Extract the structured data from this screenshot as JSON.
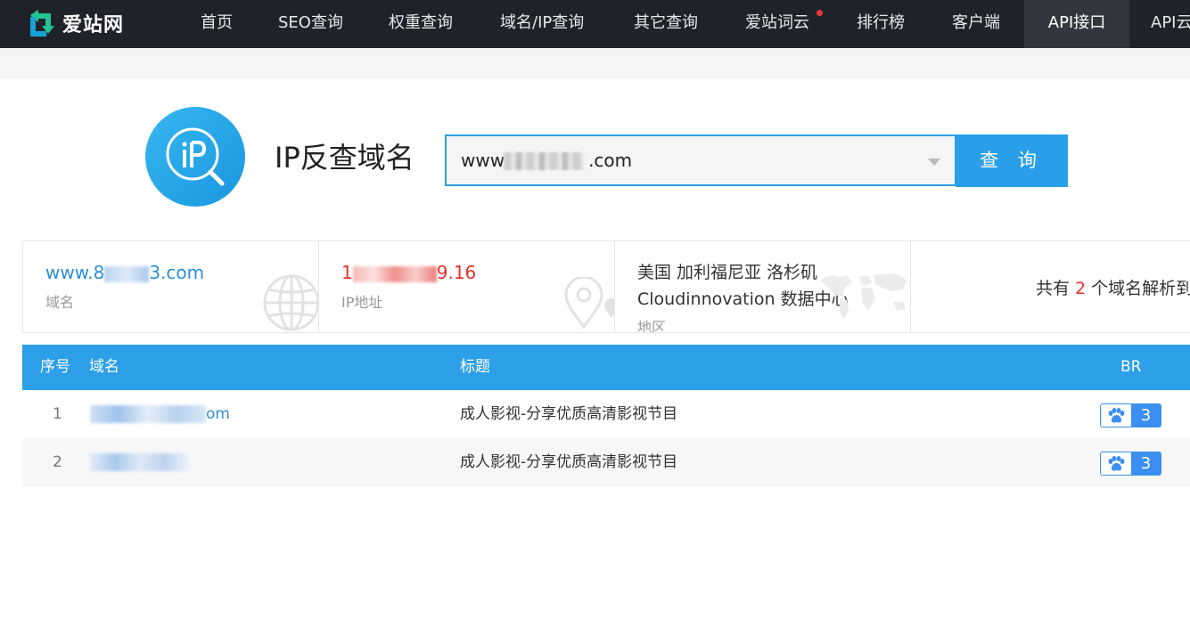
{
  "brand": {
    "name": "爱站网",
    "accent": "#2c9fe8",
    "nav_bg": "#1f2329"
  },
  "nav": {
    "items": [
      {
        "label": "首页"
      },
      {
        "label": "SEO查询"
      },
      {
        "label": "权重查询"
      },
      {
        "label": "域名/IP查询"
      },
      {
        "label": "其它查询"
      },
      {
        "label": "爱站词云"
      },
      {
        "label": "排行榜"
      },
      {
        "label": "客户端"
      },
      {
        "label": "API接口"
      },
      {
        "label": "API云"
      }
    ],
    "active": "API接口"
  },
  "search": {
    "heading": "IP反查域名",
    "badge_icon": "ip-search-icon",
    "value_prefix": "www",
    "value_suffix": ".com",
    "button_label": "查 询"
  },
  "info": {
    "domain": {
      "value_prefix": "www.8",
      "value_suffix": "3.com",
      "label": "域名",
      "icon": "globe-icon"
    },
    "ip": {
      "value_prefix": "1",
      "value_suffix": "9.16",
      "label": "IP地址",
      "icon": "location-pin-icon"
    },
    "region": {
      "line1": "美国 加利福尼亚 洛杉矶",
      "line2": "Cloudinnovation 数据中心",
      "label": "地区",
      "icon": "world-map-icon"
    },
    "summary": {
      "prefix": "共有 ",
      "count": "2",
      "suffix": " 个域名解析到"
    }
  },
  "table": {
    "headers": {
      "index": "序号",
      "domain": "域名",
      "title": "标题",
      "br": "BR"
    },
    "rows": [
      {
        "index": "1",
        "domain_suffix": "om",
        "title": "成人影视-分享优质高清影视节目",
        "br": "3"
      },
      {
        "index": "2",
        "domain_suffix": "",
        "title": "成人影视-分享优质高清影视节目",
        "br": "3"
      }
    ]
  }
}
